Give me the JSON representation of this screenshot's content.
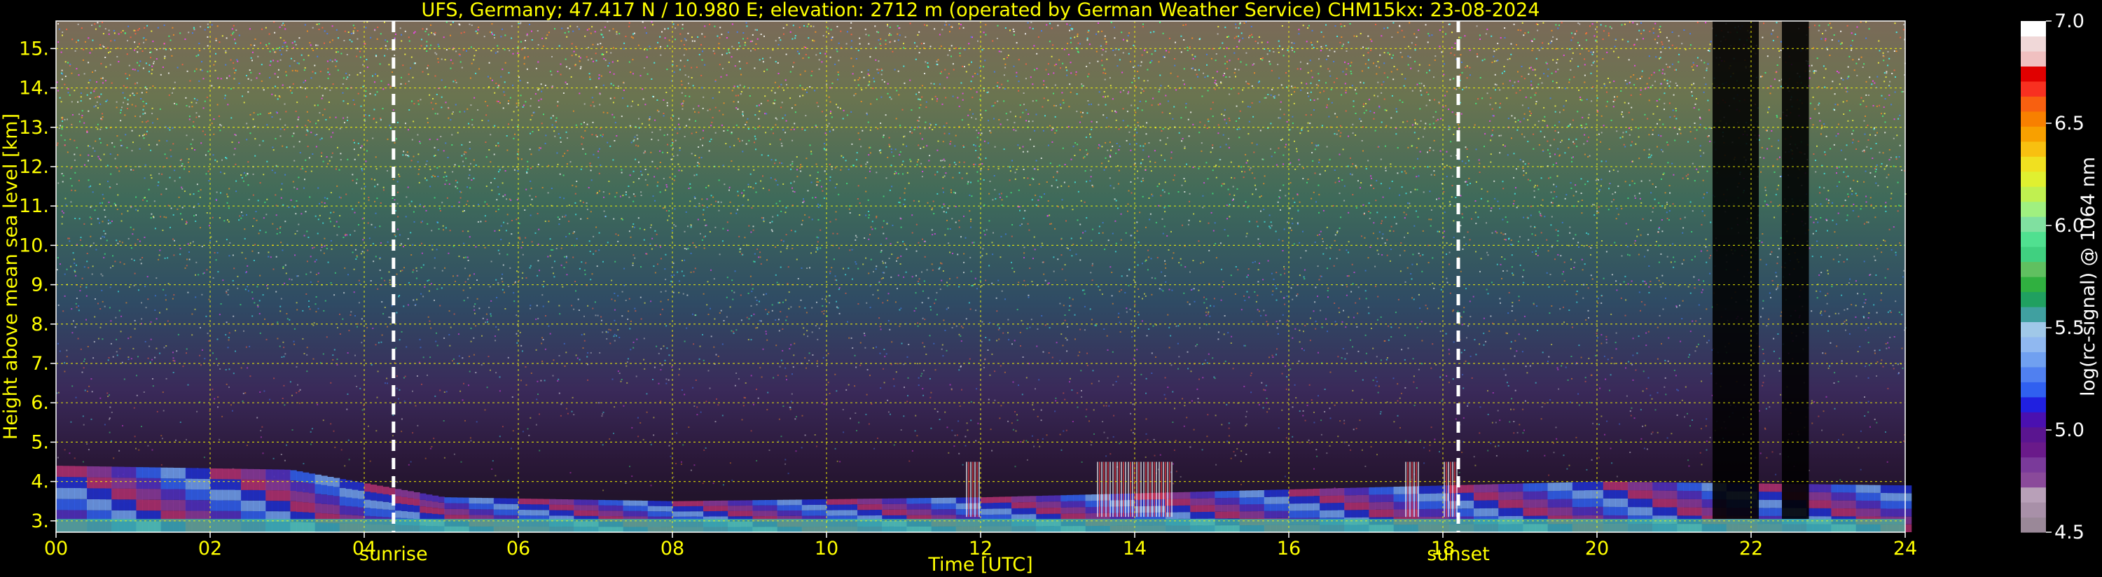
{
  "chart_data": {
    "type": "heatmap",
    "title": "UFS, Germany; 47.417 N / 10.980 E; elevation: 2712 m  (operated by German Weather Service)    CHM15kx: 23-08-2024",
    "xlabel": "Time [UTC]",
    "ylabel": "Height above mean sea level [km]",
    "xlim": [
      0,
      24
    ],
    "ylim": [
      2.712,
      15.7
    ],
    "x_ticks": [
      0,
      2,
      4,
      6,
      8,
      10,
      12,
      14,
      16,
      18,
      20,
      22,
      24
    ],
    "x_tick_labels": [
      "00",
      "02",
      "04",
      "06",
      "08",
      "10",
      "12",
      "14",
      "16",
      "18",
      "20",
      "22",
      "24"
    ],
    "y_ticks": [
      3,
      4,
      5,
      6,
      7,
      8,
      9,
      10,
      11,
      12,
      13,
      14,
      15
    ],
    "y_tick_labels": [
      "3.",
      "4.",
      "5.",
      "6.",
      "7.",
      "8.",
      "9.",
      "10.",
      "11.",
      "12.",
      "13.",
      "14.",
      "15."
    ],
    "grid": true,
    "markers": [
      {
        "label": "sunrise",
        "x": 4.38
      },
      {
        "label": "sunset",
        "x": 18.2
      }
    ],
    "colorbar": {
      "label": "log(rc-signal) @ 1064 nm",
      "range": [
        4.5,
        7.0
      ],
      "ticks": [
        4.5,
        5.0,
        5.5,
        6.0,
        6.5,
        7.0
      ],
      "tick_labels": [
        "4.5",
        "5.0",
        "5.5",
        "6.0",
        "6.5",
        "7.0"
      ],
      "colors": [
        "#9a8898",
        "#a890a8",
        "#b8a0b8",
        "#8a4a9a",
        "#7a3a9a",
        "#6a1a8a",
        "#5a1590",
        "#4a10b0",
        "#2020e0",
        "#3060f0",
        "#5080f0",
        "#70a0f0",
        "#90b8f0",
        "#a0c8e8",
        "#40a0a0",
        "#20a060",
        "#30b040",
        "#60c060",
        "#40d080",
        "#50e090",
        "#80e0a0",
        "#a0f080",
        "#c0f050",
        "#e0f030",
        "#f0e020",
        "#f8c010",
        "#f8a000",
        "#f88000",
        "#f86010",
        "#f83020",
        "#e00000",
        "#f0c0c0",
        "#f0d8d8",
        "#ffffff"
      ]
    },
    "annotations": {
      "aerosol_layer_top_km": [
        4.4,
        4.3,
        3.6,
        3.5,
        3.6,
        3.7,
        3.8,
        3.9,
        4.0,
        3.9
      ],
      "aerosol_layer_times": [
        0,
        3,
        5,
        8,
        12,
        14,
        16,
        18,
        20,
        24
      ],
      "noisy_spikes_times": [
        11.9,
        13.6,
        13.8,
        14.0,
        14.2,
        14.4,
        17.6,
        18.1
      ],
      "cloud_columns": [
        {
          "x_start": 21.5,
          "x_end": 22.1,
          "top_km": 15.7
        },
        {
          "x_start": 22.4,
          "x_end": 22.75,
          "top_km": 15.7
        }
      ]
    }
  },
  "colors": {
    "text": "#ffff00",
    "grid": "#ffff00",
    "frame": "#ffffff",
    "background": "#000000",
    "marker": "#ffffff"
  }
}
